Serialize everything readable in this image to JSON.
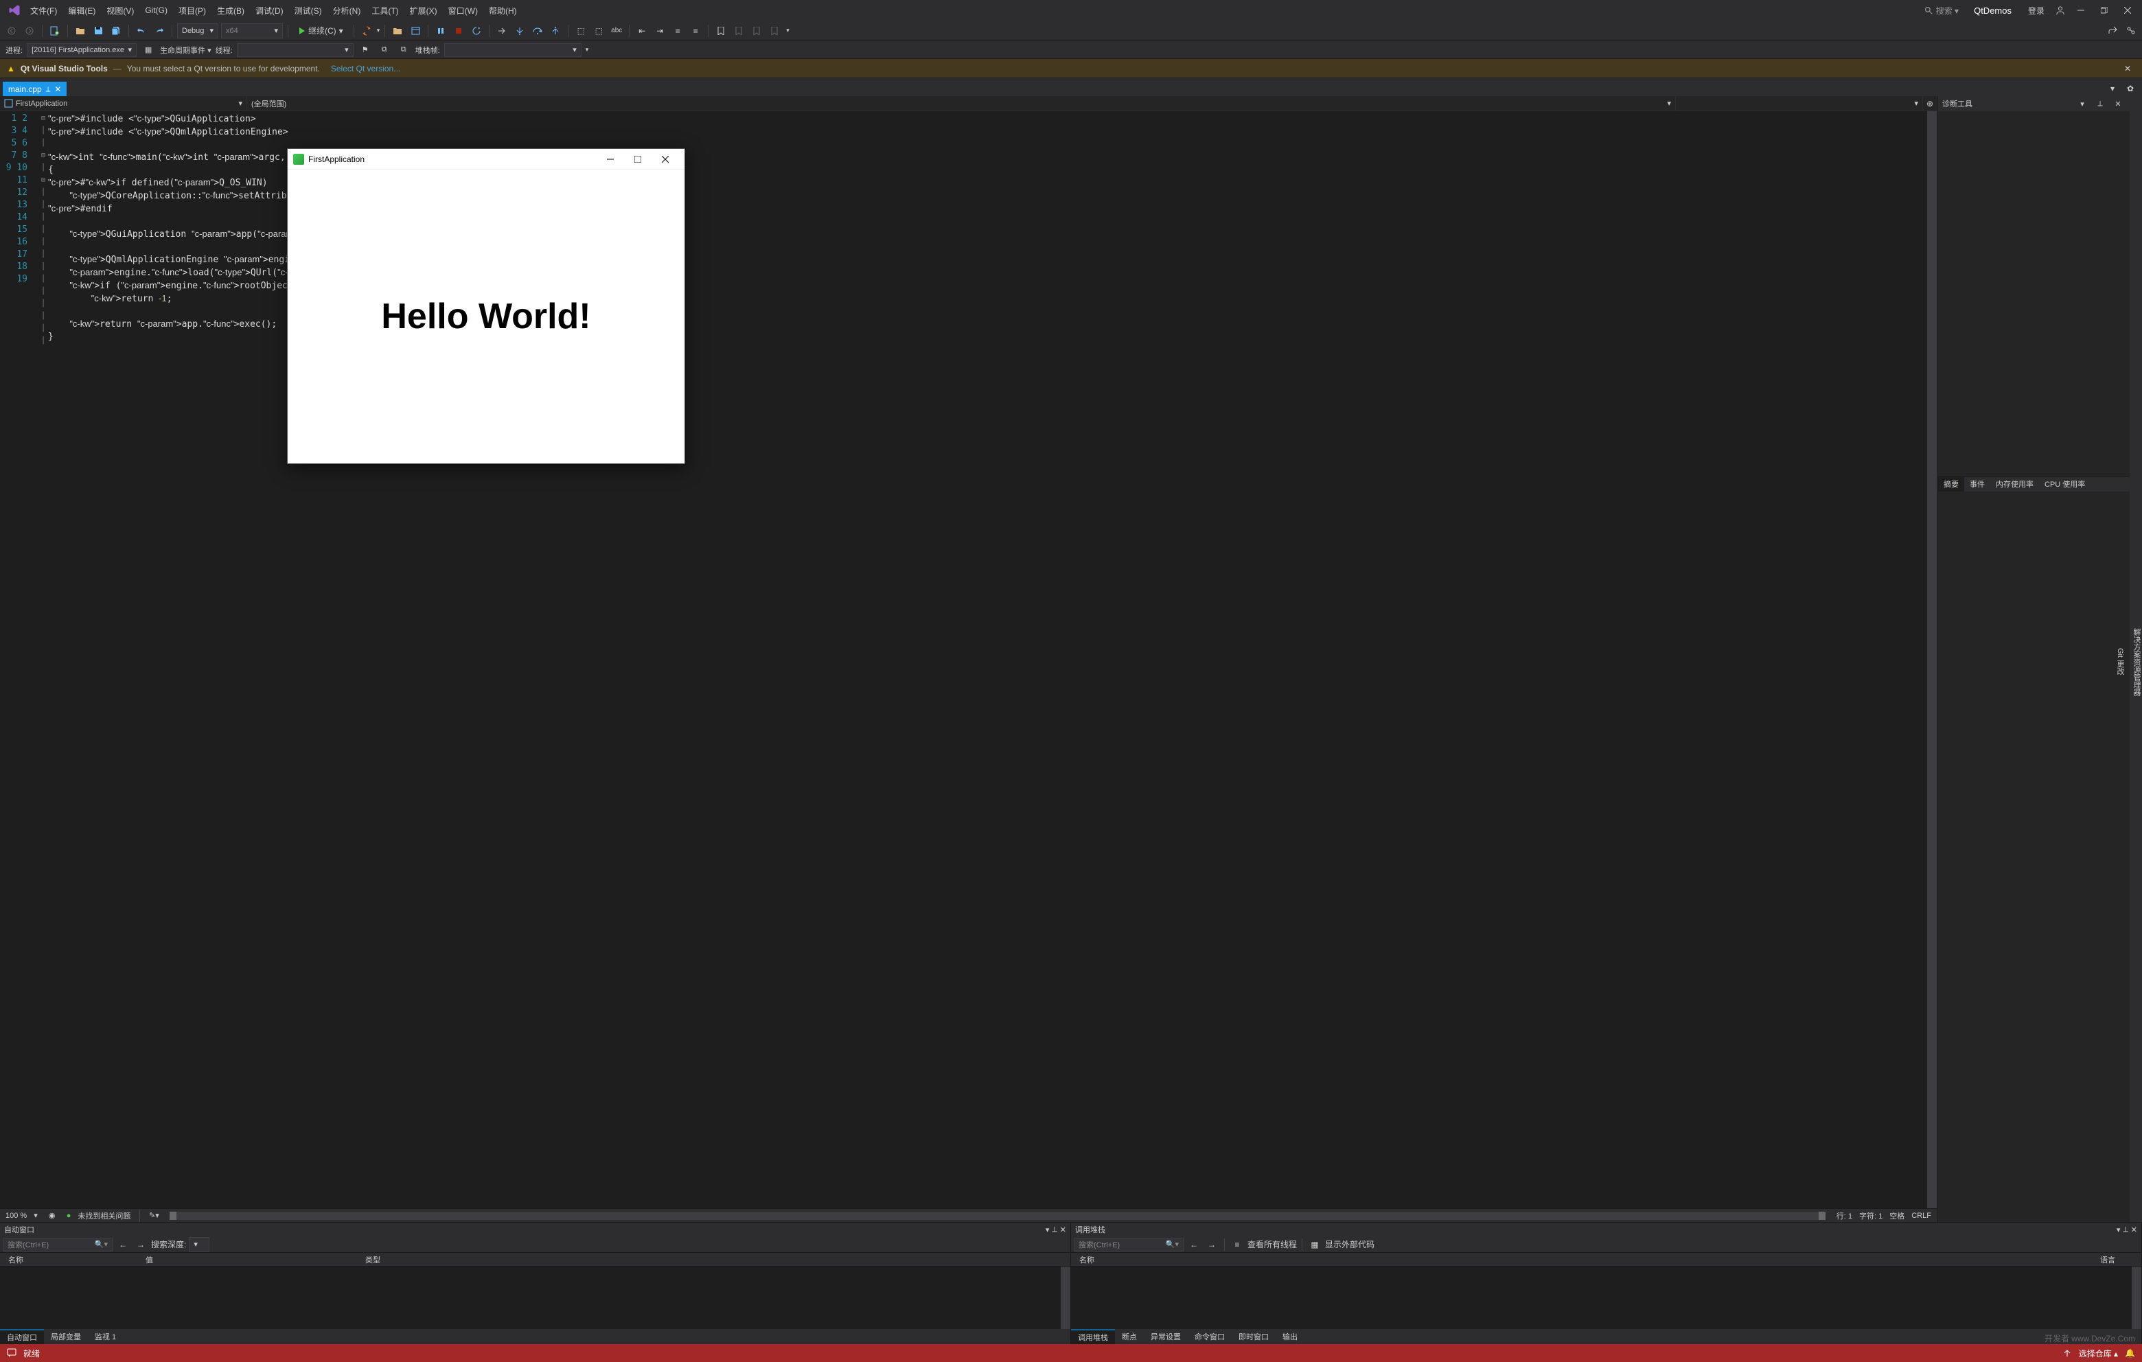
{
  "menu": [
    "文件(F)",
    "编辑(E)",
    "视图(V)",
    "Git(G)",
    "项目(P)",
    "生成(B)",
    "调试(D)",
    "测试(S)",
    "分析(N)",
    "工具(T)",
    "扩展(X)",
    "窗口(W)",
    "帮助(H)"
  ],
  "search_placeholder": "搜索 ▾",
  "solution": "QtDemos",
  "login": "登录",
  "toolbar": {
    "config": "Debug",
    "platform": "x64",
    "continue": "继续(C)"
  },
  "process_bar": {
    "label": "进程:",
    "process": "[20116] FirstApplication.exe",
    "life_label": "生命周期事件 ▾",
    "thread_label": "线程:",
    "stack_label": "堆栈帧:"
  },
  "notify": {
    "tool": "Qt Visual Studio Tools",
    "sep": "—",
    "msg": "You must select a Qt version to use for development.",
    "link": "Select Qt version..."
  },
  "file_tab": "main.cpp",
  "nav_left": "FirstApplication",
  "nav_right": "(全局范围)",
  "code_lines": [
    "#include <QGuiApplication>",
    "#include <QQmlApplicationEngine>",
    "",
    "int main(int argc, char *argv[])",
    "{",
    "#if defined(Q_OS_WIN)",
    "    QCoreApplication::setAttribute(Qt::AA_EnableHighDpiScaling);",
    "#endif",
    "",
    "    QGuiApplication app(argc, argv);",
    "",
    "    QQmlApplicationEngine engine;",
    "    engine.load(QUrl(QStringLiteral(\"qrc:/qt/qml/firstapplication/main.qml\")));",
    "    if (engine.rootObjects().isEmpty())",
    "        return -1;",
    "",
    "    return app.exec();",
    "}",
    ""
  ],
  "app_window": {
    "title": "FirstApplication",
    "hello": "Hello World!"
  },
  "editor_status": {
    "zoom": "100 %",
    "issues": "未找到相关问题",
    "line": "行: 1",
    "char": "字符: 1",
    "space": "空格",
    "crlf": "CRLF"
  },
  "diag_panel": {
    "title": "诊断工具",
    "tabs": [
      "摘要",
      "事件",
      "内存使用率",
      "CPU 使用率"
    ]
  },
  "side_tabs": [
    "解决方案资源管理器",
    "Git 更改"
  ],
  "auto_panel": {
    "title": "自动窗口",
    "search_ph": "搜索(Ctrl+E)",
    "depth_label": "搜索深度:",
    "cols": [
      "名称",
      "值",
      "类型"
    ],
    "tabs": [
      "自动窗口",
      "局部变量",
      "监视 1"
    ]
  },
  "stack_panel": {
    "title": "调用堆栈",
    "search_ph": "搜索(Ctrl+E)",
    "view_all": "查看所有线程",
    "show_ext": "显示外部代码",
    "cols": [
      "名称",
      "语言"
    ],
    "tabs": [
      "调用堆栈",
      "断点",
      "异常设置",
      "命令窗口",
      "即时窗口",
      "输出"
    ]
  },
  "status_bar": {
    "ready": "就绪",
    "repo": "选择仓库 ▴",
    "watermark": "开发者 www.DevZe.Com"
  }
}
